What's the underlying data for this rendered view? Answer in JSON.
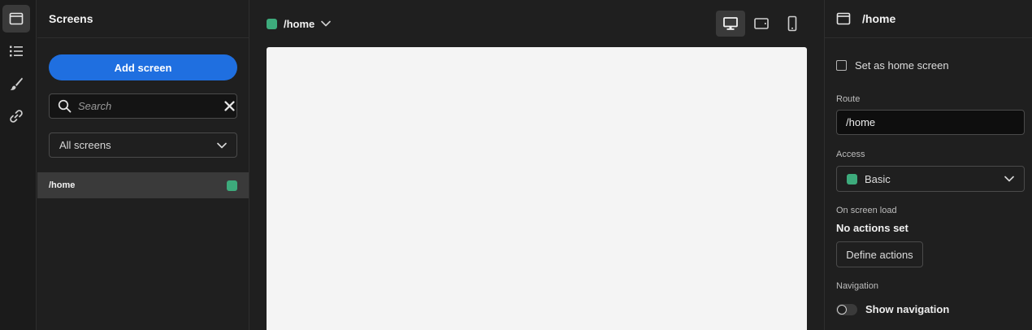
{
  "rail": {
    "items": [
      {
        "icon": "screens-icon",
        "active": true
      },
      {
        "icon": "list-icon",
        "active": false
      },
      {
        "icon": "brush-icon",
        "active": false
      },
      {
        "icon": "link-icon",
        "active": false
      }
    ]
  },
  "screens_panel": {
    "title": "Screens",
    "add_button_label": "Add screen",
    "search_placeholder": "Search",
    "filter_value": "All screens",
    "screens": [
      {
        "route": "/home",
        "status_color": "#3dab7c"
      }
    ]
  },
  "canvas_toolbar": {
    "route_label": "/home",
    "route_color": "#3dab7c",
    "devices": [
      {
        "icon": "desktop-icon",
        "active": true
      },
      {
        "icon": "tablet-icon",
        "active": false
      },
      {
        "icon": "mobile-icon",
        "active": false
      }
    ]
  },
  "settings": {
    "title": "/home",
    "set_home_label": "Set as home screen",
    "set_home_checked": false,
    "route_label": "Route",
    "route_value": "/home",
    "access_label": "Access",
    "access_value": "Basic",
    "access_color": "#3dab7c",
    "on_load_label": "On screen load",
    "no_actions_text": "No actions set",
    "define_actions_label": "Define actions",
    "navigation_label": "Navigation",
    "show_navigation_label": "Show navigation",
    "show_navigation_on": false
  },
  "colors": {
    "accent": "#1f6fe0",
    "status_green": "#3dab7c",
    "background": "#1f1f1f",
    "canvas": "#f4f4f4"
  }
}
